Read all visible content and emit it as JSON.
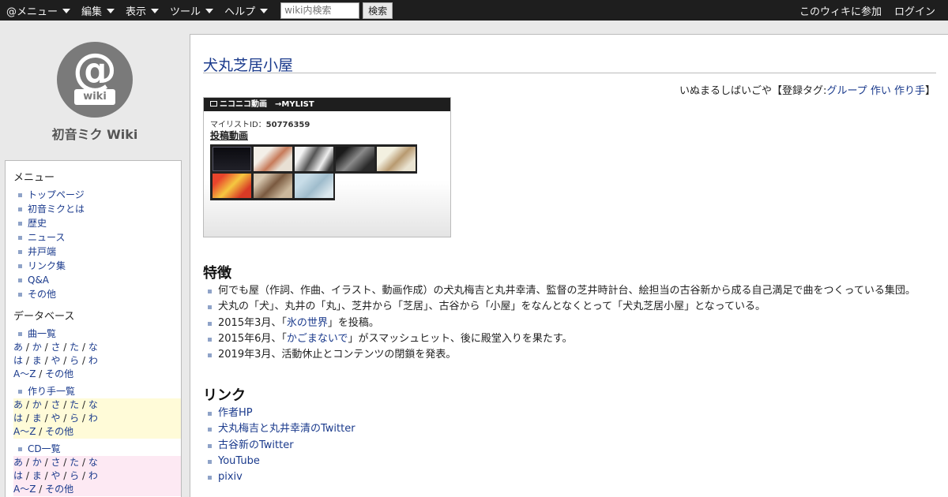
{
  "topbar": {
    "menus": [
      "@メニュー",
      "編集",
      "表示",
      "ツール",
      "ヘルプ"
    ],
    "search_placeholder": "wiki内検索",
    "search_button": "検索",
    "join": "このウィキに参加",
    "login": "ログイン"
  },
  "sidebar": {
    "logo_at": "@",
    "logo_wiki": "wiki",
    "site_name": "初音ミク Wiki",
    "menu_heading": "メニュー",
    "menu_items": [
      "トップページ",
      "初音ミクとは",
      "歴史",
      "ニュース",
      "井戸端",
      "リンク集",
      "Q&A",
      "その他"
    ],
    "db_heading": "データベース",
    "song_list": "曲一覧",
    "producer_list": "作り手一覧",
    "cd_list": "CD一覧",
    "kana": {
      "a": "あ",
      "ka": "か",
      "sa": "さ",
      "ta": "た",
      "na": "な",
      "ha": "は",
      "ma": "ま",
      "ya": "や",
      "ra": "ら",
      "wa": "わ",
      "az": "A～Z",
      "other": "その他"
    }
  },
  "main": {
    "title": "犬丸芝居小屋",
    "reading": "いぬまるしばいごや【登録タグ:",
    "tags": [
      "グループ",
      "作い",
      "作り手"
    ],
    "reading_end": "】",
    "nico": {
      "logo": "ニコニコ動画",
      "mylist_label": "→MYLIST",
      "id_label": "マイリストID：",
      "id_value": "50776359",
      "posts_link": "投稿動画"
    },
    "features_heading": "特徴",
    "features": [
      {
        "pre": "何でも屋（作詞、作曲、イラスト、動画作成）の犬丸梅吉と丸井幸清、監督の芝井時計台、絵担当の古谷新から成る自己満足で曲をつくっている集団。",
        "link": "",
        "post": ""
      },
      {
        "pre": "犬丸の「犬」、丸井の「丸」、芝井から「芝居」、古谷から「小屋」をなんとなくとって「犬丸芝居小屋」となっている。",
        "link": "",
        "post": ""
      },
      {
        "pre": "2015年3月、「",
        "link": "氷の世界",
        "post": "」を投稿。"
      },
      {
        "pre": "2015年6月、「",
        "link": "かごまないで",
        "post": "」がスマッシュヒット、後に殿堂入りを果たす。"
      },
      {
        "pre": "2019年3月、活動休止とコンテンツの閉鎖を発表。",
        "link": "",
        "post": ""
      }
    ],
    "links_heading": "リンク",
    "links": [
      "作者HP",
      "犬丸梅吉と丸井幸清のTwitter",
      "古谷新のTwitter",
      "YouTube",
      "pixiv"
    ]
  },
  "colors": {
    "topbar": "#1e1e1e",
    "link": "#1a3a8c",
    "logo": "#7a7a7a"
  }
}
